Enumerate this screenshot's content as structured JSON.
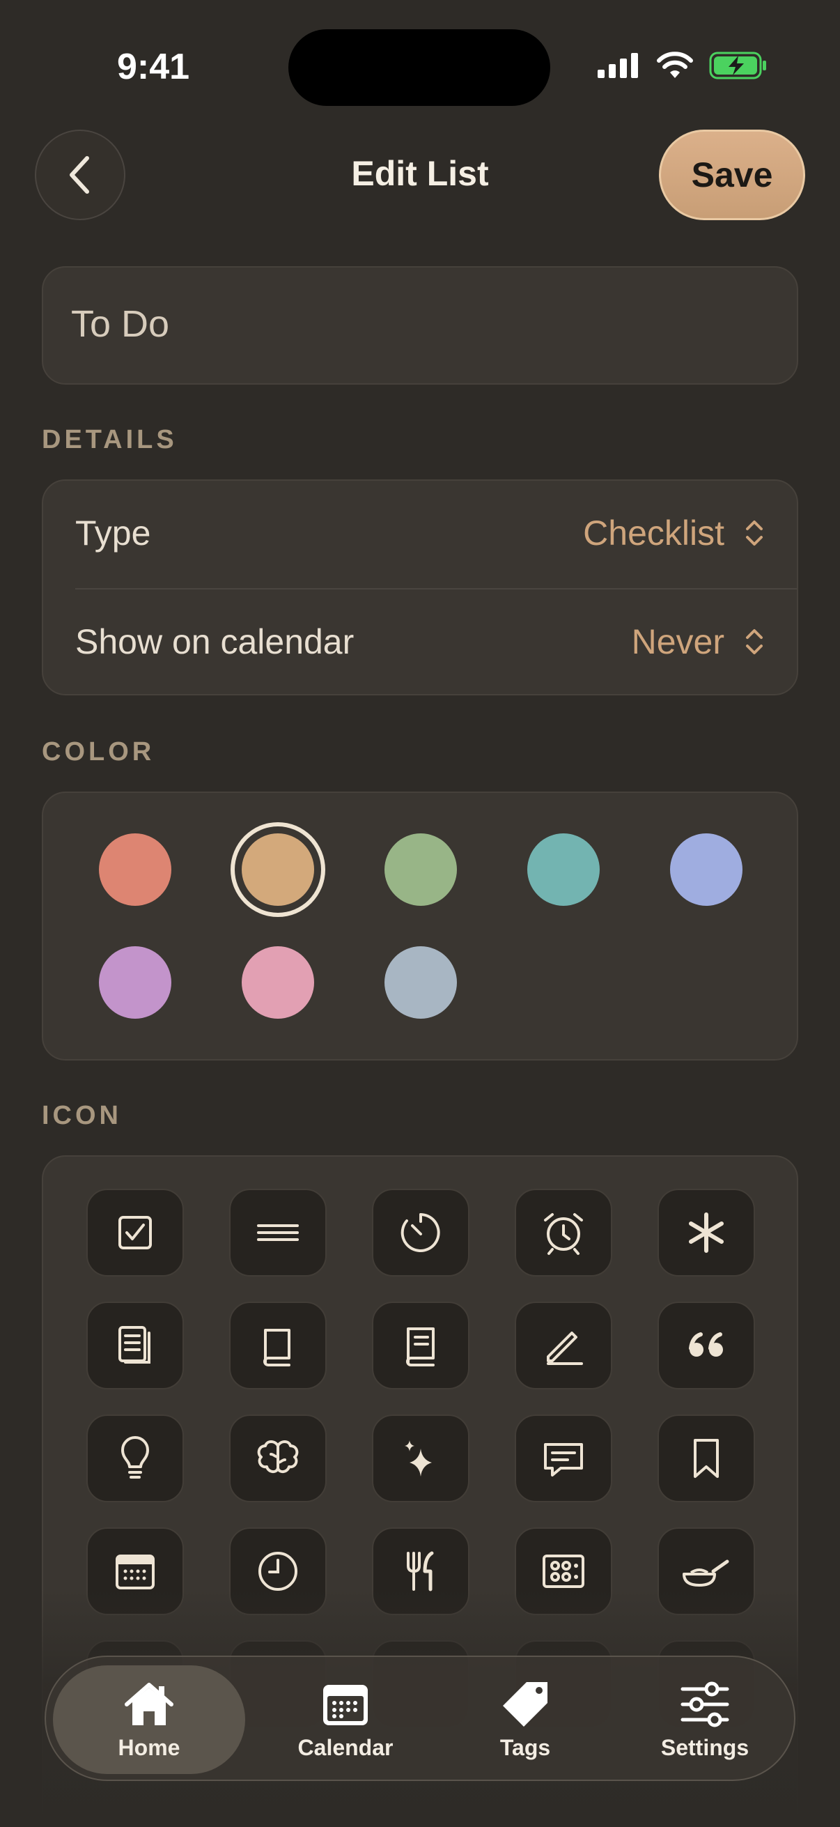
{
  "status_bar": {
    "time": "9:41"
  },
  "header": {
    "title": "Edit List",
    "save_label": "Save"
  },
  "name_field": {
    "value": "To Do"
  },
  "details": {
    "section_label": "DETAILS",
    "rows": [
      {
        "label": "Type",
        "value": "Checklist"
      },
      {
        "label": "Show on calendar",
        "value": "Never"
      }
    ]
  },
  "color": {
    "section_label": "COLOR",
    "swatches": [
      "#dd8572",
      "#d3a97b",
      "#98b587",
      "#73b4b1",
      "#9fade0",
      "#c394cb",
      "#e2a0b3",
      "#a8b6c3"
    ],
    "selected_index": 1
  },
  "icon": {
    "section_label": "ICON",
    "items": [
      "checkbox-icon",
      "lines-icon",
      "timer-icon",
      "alarm-icon",
      "asterisk-icon",
      "document-icon",
      "book-icon",
      "journal-icon",
      "pencil-icon",
      "quote-icon",
      "lightbulb-icon",
      "brain-icon",
      "sparkles-icon",
      "message-icon",
      "bookmark-icon",
      "calendar-icon",
      "clock-icon",
      "fork-knife-icon",
      "stove-icon",
      "frying-pan-icon"
    ]
  },
  "tab_bar": {
    "tabs": [
      {
        "label": "Home",
        "icon": "house-icon"
      },
      {
        "label": "Calendar",
        "icon": "calendar-icon"
      },
      {
        "label": "Tags",
        "icon": "tag-icon"
      },
      {
        "label": "Settings",
        "icon": "sliders-icon"
      }
    ],
    "active": "Home"
  }
}
